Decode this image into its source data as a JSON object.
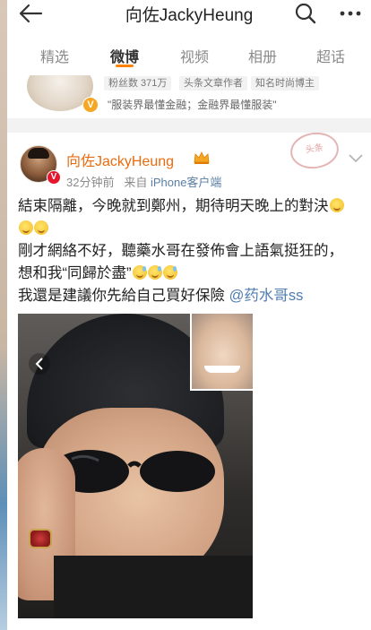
{
  "header": {
    "title": "向佐JackyHeung",
    "back_icon": "arrow-left-icon",
    "search_icon": "search-icon",
    "more_icon": "more-icon"
  },
  "tabs": [
    {
      "label": "精选"
    },
    {
      "label": "微博",
      "active": true
    },
    {
      "label": "视频"
    },
    {
      "label": "相册"
    },
    {
      "label": "超话"
    }
  ],
  "profile_strip": {
    "stats": [
      "粉丝数 371万",
      "头条文章作者",
      "知名时尚博主"
    ],
    "description": "\"服装界最懂金融；金融界最懂服装\""
  },
  "post": {
    "author": "向佐JackyHeung",
    "time": "32分钟前",
    "source_prefix": "来自",
    "source": "iPhone客户端",
    "stamp": "头条",
    "line1": "結束隔離，今晚就到鄭州，期待明天晚上的對決",
    "line2": "剛才網絡不好，聽藥水哥在發佈會上語氣挺狂的，",
    "line3": "想和我“同歸於盡”",
    "line4": "我還是建議你先給自己買好保險 ",
    "mention": "@药水哥ss"
  },
  "colors": {
    "accent": "#ff8200",
    "author_name": "#e86b0f",
    "link": "#507daf",
    "verified_red": "#e6162d",
    "verified_gold": "#f5a623"
  }
}
